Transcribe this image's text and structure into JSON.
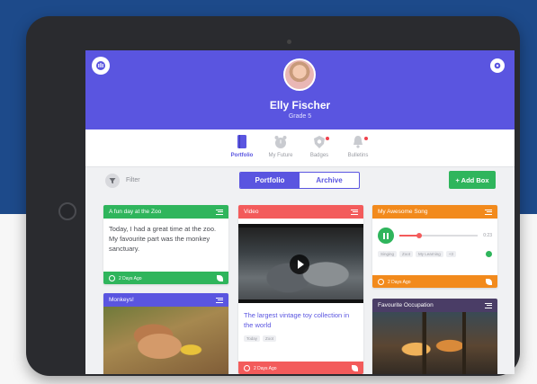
{
  "colors": {
    "accent": "#5a55e0",
    "green": "#2fb55c",
    "red": "#f35b5b",
    "orange": "#f28a1c",
    "purple": "#4a3d66"
  },
  "profile": {
    "name": "Elly Fischer",
    "grade": "Grade 5",
    "logo_icon": "app-logo-icon",
    "settings_icon": "gear-icon"
  },
  "nav": {
    "items": [
      {
        "label": "Portfolio",
        "icon": "book-icon",
        "active": true
      },
      {
        "label": "My Future",
        "icon": "alarm-clock-icon",
        "active": false
      },
      {
        "label": "Badges",
        "icon": "badge-icon",
        "active": false
      },
      {
        "label": "Bulletins",
        "icon": "bell-icon",
        "active": false
      }
    ]
  },
  "toolbar": {
    "filter_label": "Filter",
    "segments": [
      "Portfolio",
      "Archive"
    ],
    "active_segment": "Portfolio",
    "add_button": "+ Add Box"
  },
  "cards": {
    "zoo": {
      "title": "A fun day at the Zoo",
      "body": "Today, I had a great time at the zoo. My favourite part was the monkey sanctuary.",
      "footer": "2 Days Ago"
    },
    "monkeys": {
      "title": "Monkeys!"
    },
    "video": {
      "title": "Video",
      "caption": "The largest vintage toy collection in the world",
      "tags": [
        "Today",
        "Zoot"
      ],
      "footer": "2 Days Ago"
    },
    "song": {
      "title": "My Awesome Song",
      "time": "0:23",
      "progress": 0.25,
      "tags": [
        "Singing",
        "Zoot",
        "My Learning",
        "+3"
      ],
      "footer": "2 Days Ago"
    },
    "occupation": {
      "title": "Favourite Occupation"
    }
  }
}
